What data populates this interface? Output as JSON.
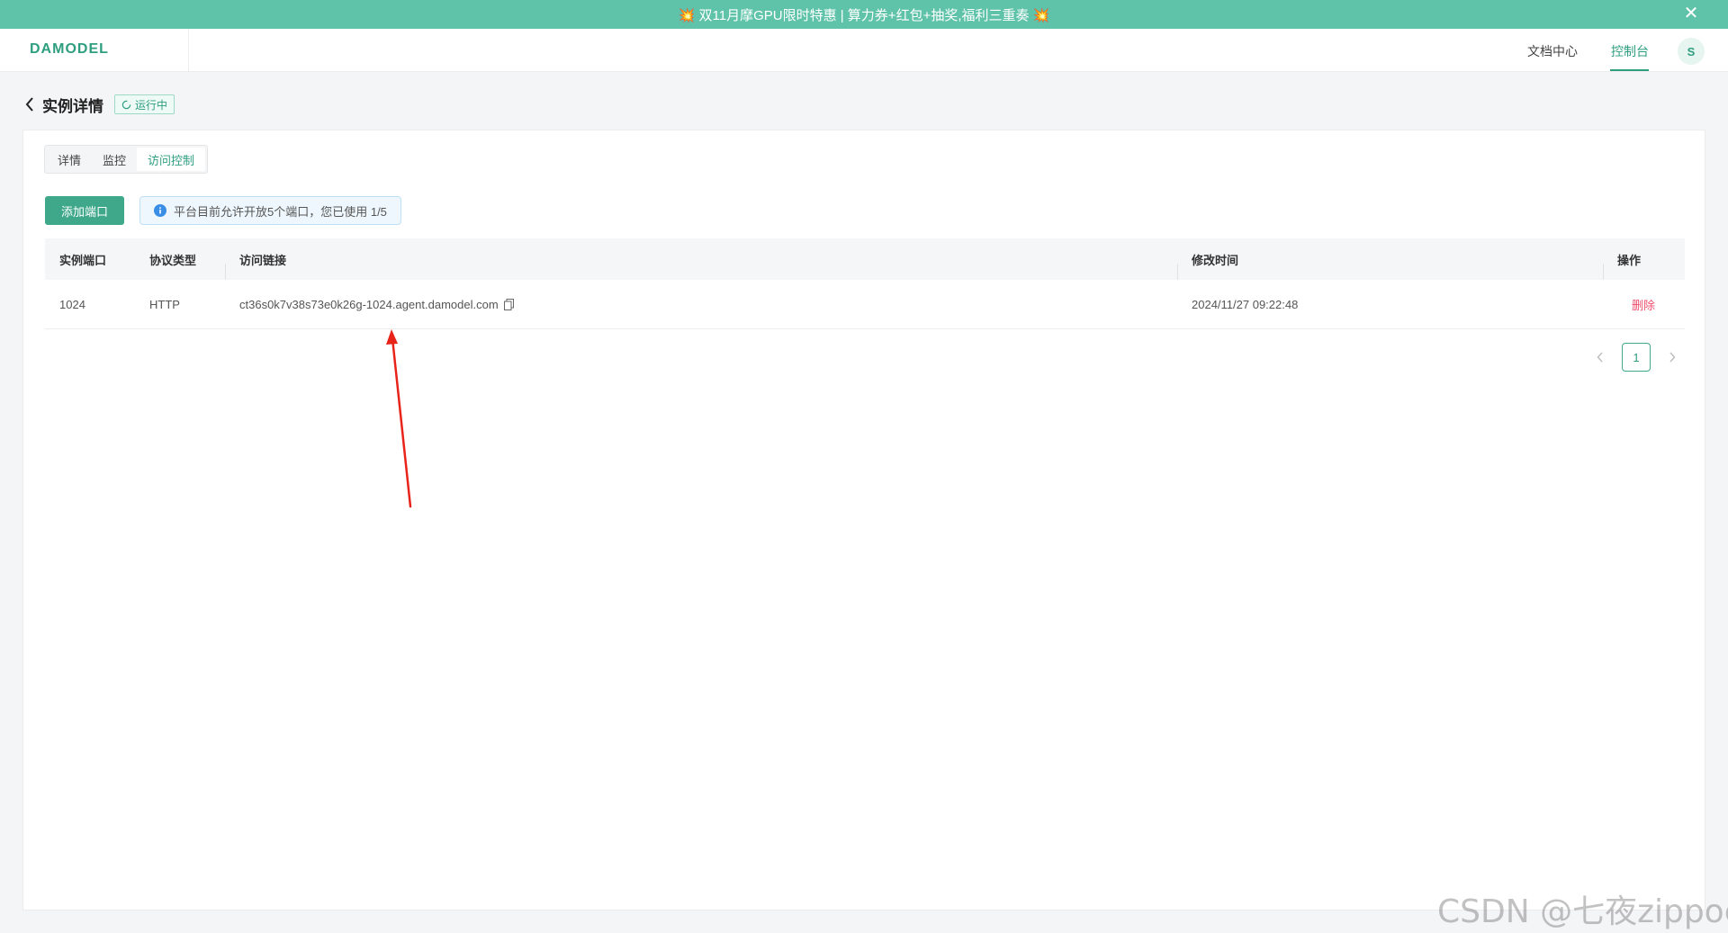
{
  "banner": {
    "text": "💥 双11月摩GPU限时特惠 | 算力券+红包+抽奖,福利三重奏 💥",
    "close": "✕"
  },
  "topnav": {
    "logo": "DAMODEL",
    "docs": "文档中心",
    "console": "控制台",
    "avatar": "S"
  },
  "page": {
    "title": "实例详情",
    "status": "运行中"
  },
  "tabs": [
    "详情",
    "监控",
    "访问控制"
  ],
  "actions": {
    "add_port": "添加端口",
    "tip": "平台目前允许开放5个端口，您已使用 1/5"
  },
  "table": {
    "headers": [
      "实例端口",
      "协议类型",
      "访问链接",
      "修改时间",
      "操作"
    ],
    "rows": [
      {
        "port": "1024",
        "protocol": "HTTP",
        "link": "ct36s0k7v38s73e0k26g-1024.agent.damodel.com",
        "time": "2024/11/27 09:22:48",
        "action": "删除"
      }
    ]
  },
  "pagination": {
    "current": "1"
  },
  "watermark": "CSDN @七夜zippoe",
  "colors": {
    "accent": "#2e9e7f",
    "banner": "#5fc3a9",
    "danger": "#f0506e",
    "annotation_arrow": "#e8231a"
  }
}
